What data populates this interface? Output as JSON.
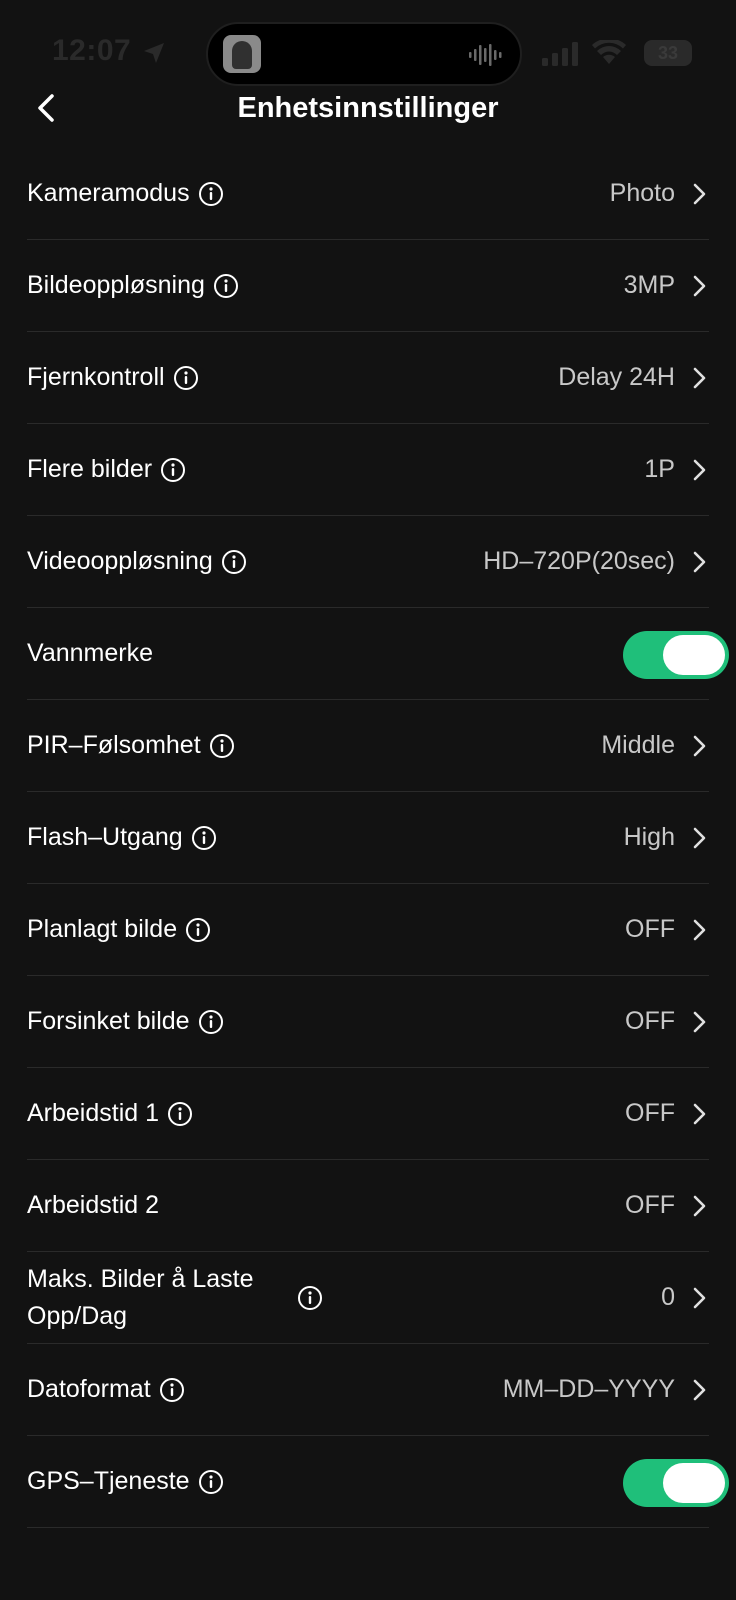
{
  "status_bar": {
    "time": "12:07",
    "battery": "33"
  },
  "header": {
    "title": "Enhetsinnstillinger"
  },
  "settings": [
    {
      "label": "Kameramodus",
      "value": "Photo"
    },
    {
      "label": "Bildeoppløsning",
      "value": "3MP"
    },
    {
      "label": "Fjernkontroll",
      "value": "Delay 24H"
    },
    {
      "label": "Flere bilder",
      "value": "1P"
    },
    {
      "label": "Videooppløsning",
      "value": "HD–720P(20sec)"
    },
    {
      "label": "Vannmerke",
      "toggle": "on"
    },
    {
      "label": "PIR–Følsomhet",
      "value": "Middle"
    },
    {
      "label": "Flash–Utgang",
      "value": "High"
    },
    {
      "label": "Planlagt bilde",
      "value": "OFF"
    },
    {
      "label": "Forsinket bilde",
      "value": "OFF"
    },
    {
      "label": "Arbeidstid 1",
      "value": "OFF"
    },
    {
      "label": "Arbeidstid 2",
      "value": "OFF"
    },
    {
      "label": "Maks. Bilder å Laste Opp/Dag",
      "value": "0"
    },
    {
      "label": "Datoformat",
      "value": "MM–DD–YYYY"
    },
    {
      "label": "GPS–Tjeneste",
      "toggle": "on"
    }
  ],
  "colors": {
    "background": "#121212",
    "toggle_on": "#1fbf7a",
    "divider": "#2a2a2a",
    "value_text": "#c8c8c8"
  }
}
